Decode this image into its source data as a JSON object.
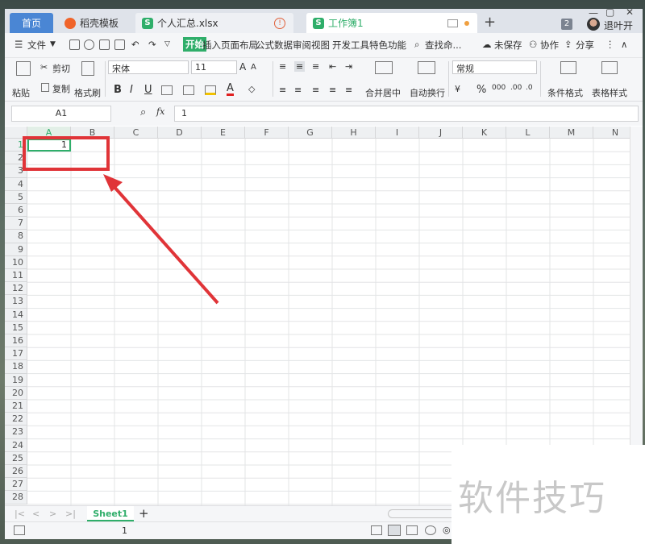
{
  "tabs": {
    "home": "首页",
    "daoke": "稻壳模板",
    "file": "个人汇总.xlsx",
    "workbook": "工作簿1",
    "new_tab": "+",
    "badge": "2",
    "logout": "退叶开"
  },
  "menu": {
    "file": "文件",
    "items": [
      "开始",
      "插入",
      "页面布局",
      "公式",
      "数据",
      "审阅",
      "视图",
      "开发工具",
      "特色功能"
    ],
    "search": "查找命...",
    "unsaved": "未保存",
    "collab": "协作",
    "share": "分享"
  },
  "ribbon": {
    "paste": "粘贴",
    "cut": "剪切",
    "copy": "复制",
    "format_painter": "格式刷",
    "font_name": "宋体",
    "font_size": "11",
    "bold": "B",
    "italic": "I",
    "underline": "U",
    "merge_center": "合并居中",
    "wrap_text": "自动换行",
    "number_format": "常规",
    "conditional_format": "条件格式",
    "table_style": "表格样式"
  },
  "formula_bar": {
    "name_box": "A1",
    "fx": "fx",
    "value": "1"
  },
  "grid": {
    "columns": [
      "A",
      "B",
      "C",
      "D",
      "E",
      "F",
      "G",
      "H",
      "I",
      "J",
      "K",
      "L",
      "M",
      "N"
    ],
    "rows": [
      "1",
      "2",
      "3",
      "4",
      "5",
      "6",
      "7",
      "8",
      "9",
      "10",
      "11",
      "12",
      "13",
      "14",
      "15",
      "16",
      "17",
      "18",
      "19",
      "20",
      "21",
      "22",
      "23",
      "24",
      "25",
      "26",
      "27",
      "28"
    ],
    "a1_value": "1"
  },
  "sheets": {
    "active": "Sheet1",
    "add": "+"
  },
  "status": {
    "sum_value": "1"
  },
  "watermark": "软件技巧",
  "colors": {
    "accent_green": "#2fae6a",
    "highlight_red": "#e03438",
    "home_tab_blue": "#4a86d4"
  }
}
